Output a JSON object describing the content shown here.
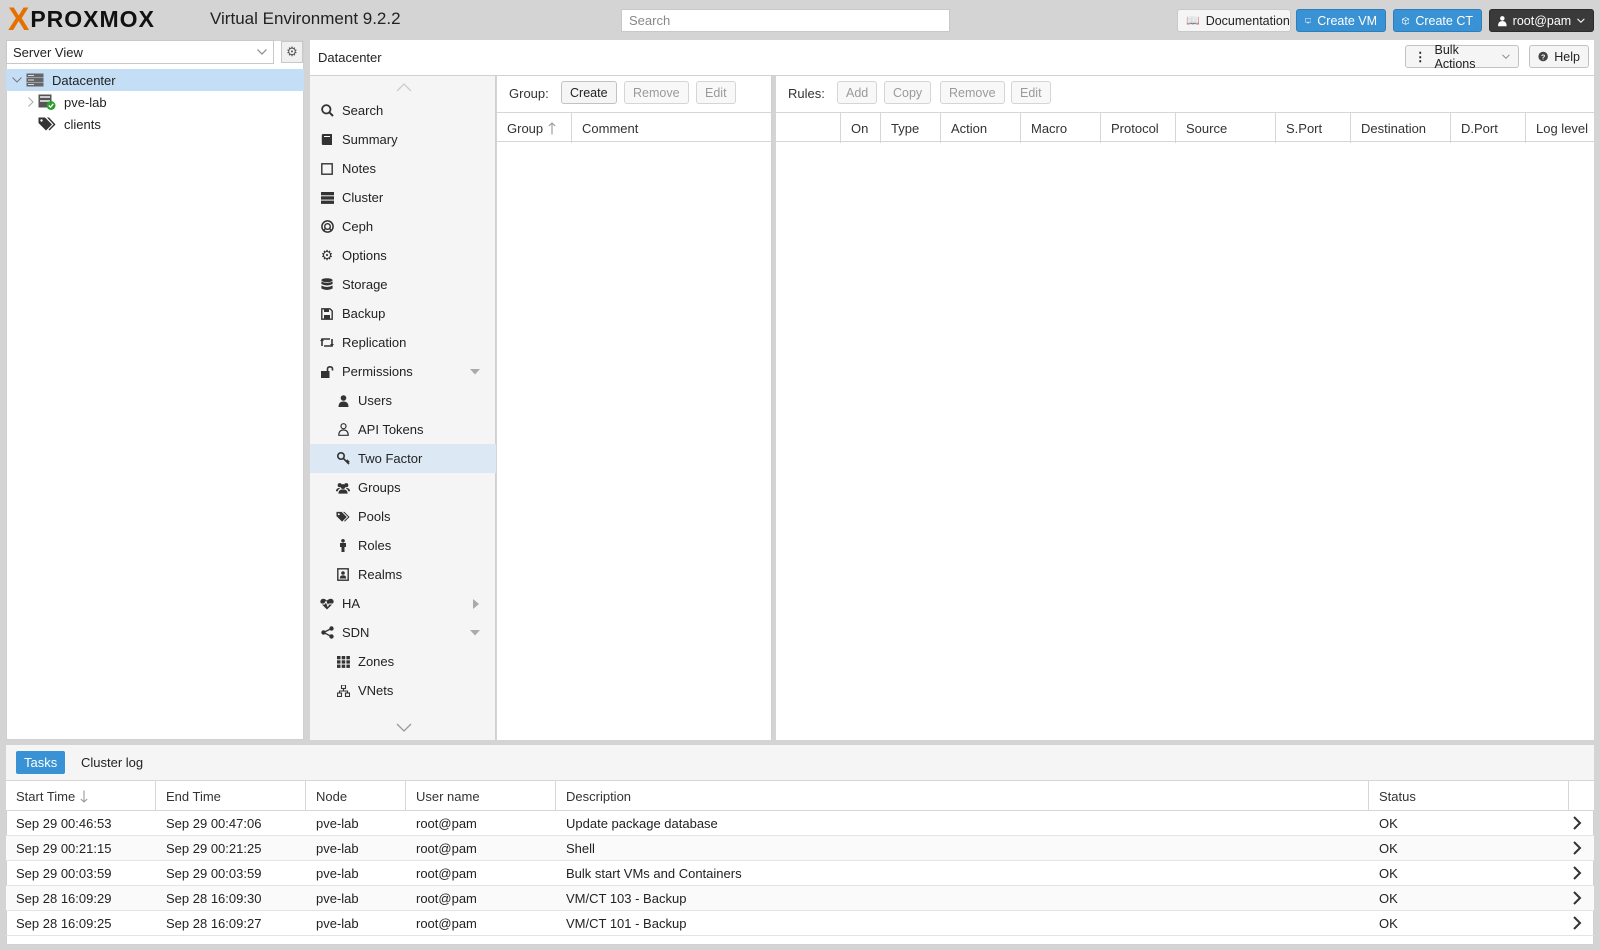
{
  "app": {
    "logo_mark": "X",
    "logo_word": "PROXMOX",
    "title": "Virtual Environment 9.2.2"
  },
  "search": {
    "placeholder": "Search"
  },
  "top_buttons": {
    "documentation": "Documentation",
    "create_vm": "Create VM",
    "create_ct": "Create CT",
    "user": "root@pam"
  },
  "tree": {
    "view_select": "Server View",
    "items": [
      {
        "label": "Datacenter",
        "icon": "datacenter-icon"
      },
      {
        "label": "pve-lab",
        "icon": "node-online-icon"
      },
      {
        "label": "clients",
        "icon": "tags-icon"
      }
    ]
  },
  "content": {
    "breadcrumb": "Datacenter",
    "bulk_actions": "Bulk Actions",
    "help": "Help"
  },
  "nav": {
    "items": [
      {
        "label": "Search",
        "icon": "search-icon"
      },
      {
        "label": "Summary",
        "icon": "book-icon"
      },
      {
        "label": "Notes",
        "icon": "note-icon"
      },
      {
        "label": "Cluster",
        "icon": "server-icon"
      },
      {
        "label": "Ceph",
        "icon": "ceph-icon"
      },
      {
        "label": "Options",
        "icon": "gear-icon"
      },
      {
        "label": "Storage",
        "icon": "database-icon"
      },
      {
        "label": "Backup",
        "icon": "floppy-icon"
      },
      {
        "label": "Replication",
        "icon": "retweet-icon"
      },
      {
        "label": "Permissions",
        "icon": "unlock-icon"
      },
      {
        "label": "Users",
        "icon": "user-icon"
      },
      {
        "label": "API Tokens",
        "icon": "user-outline-icon"
      },
      {
        "label": "Two Factor",
        "icon": "key-icon"
      },
      {
        "label": "Groups",
        "icon": "users-icon"
      },
      {
        "label": "Pools",
        "icon": "tags-icon"
      },
      {
        "label": "Roles",
        "icon": "male-icon"
      },
      {
        "label": "Realms",
        "icon": "address-book-icon"
      },
      {
        "label": "HA",
        "icon": "heartbeat-icon"
      },
      {
        "label": "SDN",
        "icon": "share-alt-icon"
      },
      {
        "label": "Zones",
        "icon": "th-icon"
      },
      {
        "label": "VNets",
        "icon": "network-icon"
      }
    ]
  },
  "group_panel": {
    "label": "Group:",
    "create": "Create",
    "remove": "Remove",
    "edit": "Edit",
    "columns": [
      "Group",
      "Comment"
    ]
  },
  "rules_panel": {
    "label": "Rules:",
    "add": "Add",
    "copy": "Copy",
    "remove": "Remove",
    "edit": "Edit",
    "columns": [
      "On",
      "Type",
      "Action",
      "Macro",
      "Protocol",
      "Source",
      "S.Port",
      "Destination",
      "D.Port",
      "Log level"
    ]
  },
  "log": {
    "tabs": [
      "Tasks",
      "Cluster log"
    ],
    "columns": [
      "Start Time",
      "End Time",
      "Node",
      "User name",
      "Description",
      "Status"
    ],
    "rows": [
      {
        "start": "Sep 29 00:46:53",
        "end": "Sep 29 00:47:06",
        "node": "pve-lab",
        "user": "root@pam",
        "desc": "Update package database",
        "status": "OK"
      },
      {
        "start": "Sep 29 00:21:15",
        "end": "Sep 29 00:21:25",
        "node": "pve-lab",
        "user": "root@pam",
        "desc": "Shell",
        "status": "OK"
      },
      {
        "start": "Sep 29 00:03:59",
        "end": "Sep 29 00:03:59",
        "node": "pve-lab",
        "user": "root@pam",
        "desc": "Bulk start VMs and Containers",
        "status": "OK"
      },
      {
        "start": "Sep 28 16:09:29",
        "end": "Sep 28 16:09:30",
        "node": "pve-lab",
        "user": "root@pam",
        "desc": "VM/CT 103 - Backup",
        "status": "OK"
      },
      {
        "start": "Sep 28 16:09:25",
        "end": "Sep 28 16:09:27",
        "node": "pve-lab",
        "user": "root@pam",
        "desc": "VM/CT 101 - Backup",
        "status": "OK"
      }
    ]
  },
  "colors": {
    "accent": "#3892d4",
    "logo_orange": "#e57000",
    "selection": "#c4dff5",
    "status_ok": "#2ca02c"
  }
}
